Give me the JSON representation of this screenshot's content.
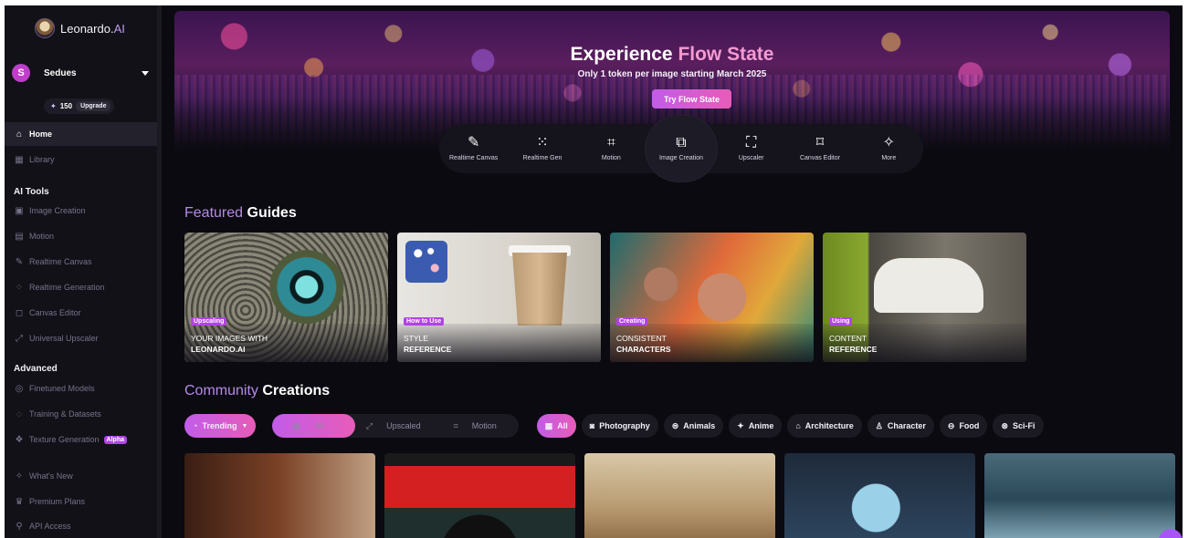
{
  "brand": {
    "name_main": "Leonardo.",
    "name_accent": "AI"
  },
  "user": {
    "initial": "S",
    "name": "Sedues",
    "tokens": "150",
    "upgrade_label": "Upgrade"
  },
  "sidebar": {
    "home": "Home",
    "library": "Library",
    "ai_tools_header": "AI Tools",
    "ai_tools": [
      "Image Creation",
      "Motion",
      "Realtime Canvas",
      "Realtime Generation",
      "Canvas Editor",
      "Universal Upscaler"
    ],
    "advanced_header": "Advanced",
    "advanced": [
      "Finetuned Models",
      "Training & Datasets",
      "Texture Generation"
    ],
    "alpha_badge": "Alpha",
    "footer": [
      "What's New",
      "Premium Plans",
      "API Access"
    ]
  },
  "hero": {
    "title_main": "Experience ",
    "title_accent": "Flow State",
    "subtitle": "Only 1 token per image starting March 2025",
    "button": "Try Flow State"
  },
  "tools": [
    {
      "label": "Realtime Canvas",
      "icon": "brush-icon"
    },
    {
      "label": "Realtime Gen",
      "icon": "dots-grid-icon"
    },
    {
      "label": "Motion",
      "icon": "film-icon"
    },
    {
      "label": "Image Creation",
      "icon": "images-icon"
    },
    {
      "label": "Upscaler",
      "icon": "upscale-icon"
    },
    {
      "label": "Canvas Editor",
      "icon": "crop-icon"
    },
    {
      "label": "More",
      "icon": "sparkle-icon"
    }
  ],
  "featured": {
    "title_accent": "Featured",
    "title_main": " Guides",
    "guides": [
      {
        "tag": "Upscaling",
        "line1": "YOUR IMAGES WITH",
        "line2": "LEONARDO.AI"
      },
      {
        "tag": "How to Use",
        "line1": "STYLE",
        "line2": "REFERENCE"
      },
      {
        "tag": "Creating",
        "line1": "CONSISTENT",
        "line2": "CHARACTERS"
      },
      {
        "tag": "Using",
        "line1": "CONTENT",
        "line2": "REFERENCE"
      }
    ]
  },
  "community": {
    "title_accent": "Community",
    "title_main": " Creations",
    "sort": "Trending",
    "view_filters": [
      "All",
      "Upscaled",
      "Motion"
    ],
    "categories": [
      "All",
      "Photography",
      "Animals",
      "Anime",
      "Architecture",
      "Character",
      "Food",
      "Sci-Fi"
    ]
  },
  "colors": {
    "accent": "#c25ce8",
    "accent2": "#e85cb8",
    "background": "#0b0a10",
    "sidebar": "#121118"
  }
}
